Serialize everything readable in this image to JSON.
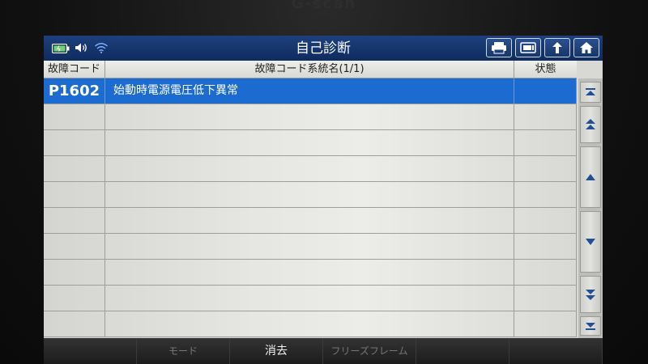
{
  "device": {
    "brand": "G-scan"
  },
  "titlebar": {
    "title": "自己診断",
    "status_icons": [
      "battery-icon",
      "speaker-icon",
      "wifi-icon"
    ],
    "nav_buttons": [
      "printer-icon",
      "screenshot-icon",
      "back-icon",
      "home-icon"
    ]
  },
  "table": {
    "headers": {
      "code": "故障コード",
      "name": "故障コード系統名(1/1)",
      "status": "状態"
    },
    "rows": [
      {
        "code": "P1602",
        "name": "始動時電源電圧低下異常",
        "status": "",
        "selected": true
      },
      {
        "code": "",
        "name": "",
        "status": ""
      },
      {
        "code": "",
        "name": "",
        "status": ""
      },
      {
        "code": "",
        "name": "",
        "status": ""
      },
      {
        "code": "",
        "name": "",
        "status": ""
      },
      {
        "code": "",
        "name": "",
        "status": ""
      },
      {
        "code": "",
        "name": "",
        "status": ""
      },
      {
        "code": "",
        "name": "",
        "status": ""
      },
      {
        "code": "",
        "name": "",
        "status": ""
      },
      {
        "code": "",
        "name": "",
        "status": ""
      }
    ]
  },
  "scroll": [
    "scroll-top-icon",
    "page-up-icon",
    "arrow-up-icon",
    "arrow-down-icon",
    "page-down-icon",
    "scroll-bottom-icon"
  ],
  "funcbar": {
    "buttons": [
      "",
      "モード",
      "消去",
      "フリーズフレーム",
      "",
      ""
    ]
  },
  "colors": {
    "titlebar": "#0f2c5f",
    "selection": "#1c6bd0"
  }
}
